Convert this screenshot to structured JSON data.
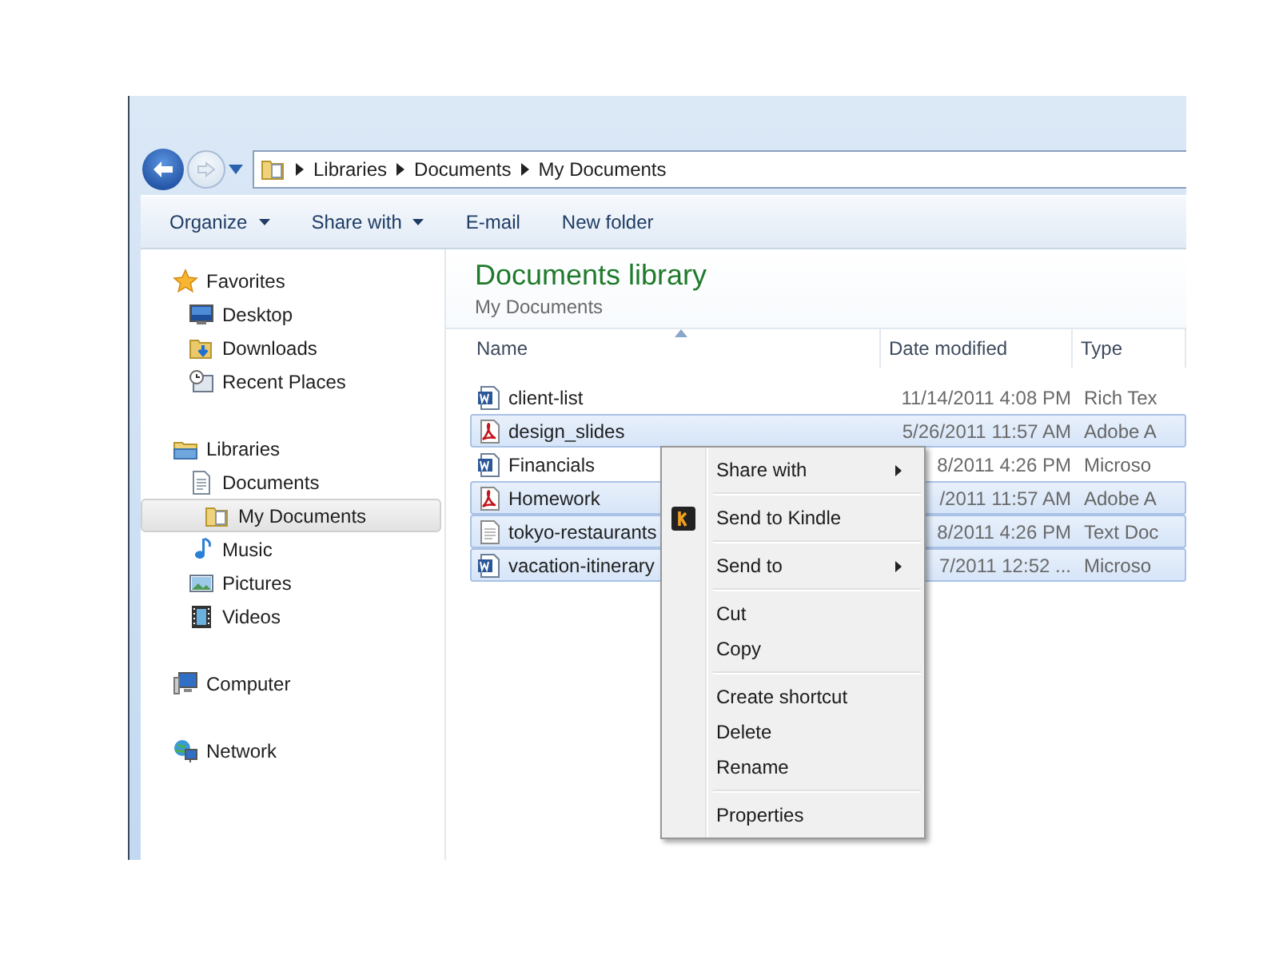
{
  "address_bar": {
    "breadcrumbs": [
      "Libraries",
      "Documents",
      "My Documents"
    ]
  },
  "toolbar": [
    {
      "label": "Organize",
      "dropdown": true
    },
    {
      "label": "Share with",
      "dropdown": true
    },
    {
      "label": "E-mail",
      "dropdown": false
    },
    {
      "label": "New folder",
      "dropdown": false
    }
  ],
  "sidebar": {
    "items": [
      {
        "label": "Favorites",
        "kind": "star",
        "selected": false,
        "children": [
          {
            "label": "Desktop",
            "kind": "desktop",
            "selected": false
          },
          {
            "label": "Downloads",
            "kind": "downloads",
            "selected": false
          },
          {
            "label": "Recent Places",
            "kind": "recent",
            "selected": false
          }
        ]
      },
      {
        "label": "Libraries",
        "kind": "library",
        "selected": false,
        "children": [
          {
            "label": "Documents",
            "kind": "document",
            "selected": false,
            "children": [
              {
                "label": "My Documents",
                "kind": "folder",
                "selected": true
              }
            ]
          },
          {
            "label": "Music",
            "kind": "music",
            "selected": false
          },
          {
            "label": "Pictures",
            "kind": "pictures",
            "selected": false
          },
          {
            "label": "Videos",
            "kind": "videos",
            "selected": false
          }
        ]
      },
      {
        "label": "Computer",
        "kind": "computer",
        "selected": false
      },
      {
        "label": "Network",
        "kind": "network",
        "selected": false
      }
    ]
  },
  "library": {
    "title": "Documents library",
    "subtitle": "My Documents"
  },
  "table": {
    "columns": [
      {
        "label": "Name",
        "sorted": true
      },
      {
        "label": "Date modified",
        "sorted": false
      },
      {
        "label": "Type",
        "sorted": false
      }
    ],
    "rows": [
      {
        "name": "client-list",
        "kind": "word",
        "date": "11/14/2011 4:08 PM",
        "type": "Rich Tex",
        "selected": false
      },
      {
        "name": "design_slides",
        "kind": "pdf",
        "date": "5/26/2011 11:57 AM",
        "type": "Adobe A",
        "selected": true
      },
      {
        "name": "Financials",
        "kind": "word",
        "date": "8/2011 4:26 PM",
        "type": "Microso",
        "selected": false
      },
      {
        "name": "Homework",
        "kind": "pdf",
        "date": "/2011 11:57 AM",
        "type": "Adobe A",
        "selected": true
      },
      {
        "name": "tokyo-restaurants",
        "kind": "text",
        "date": "8/2011 4:26 PM",
        "type": "Text Doc",
        "selected": true
      },
      {
        "name": "vacation-itinerary",
        "kind": "word",
        "date": "7/2011 12:52 ...",
        "type": "Microso",
        "selected": true
      }
    ]
  },
  "context_menu": {
    "items": [
      {
        "kind": "submenu",
        "label": "Share with"
      },
      {
        "kind": "separator"
      },
      {
        "kind": "app",
        "label": "Send to Kindle"
      },
      {
        "kind": "separator"
      },
      {
        "kind": "submenu",
        "label": "Send to"
      },
      {
        "kind": "separator"
      },
      {
        "kind": "item",
        "label": "Cut"
      },
      {
        "kind": "item",
        "label": "Copy"
      },
      {
        "kind": "separator"
      },
      {
        "kind": "item",
        "label": "Create shortcut"
      },
      {
        "kind": "item",
        "label": "Delete"
      },
      {
        "kind": "item",
        "label": "Rename"
      },
      {
        "kind": "separator"
      },
      {
        "kind": "item",
        "label": "Properties"
      }
    ]
  }
}
